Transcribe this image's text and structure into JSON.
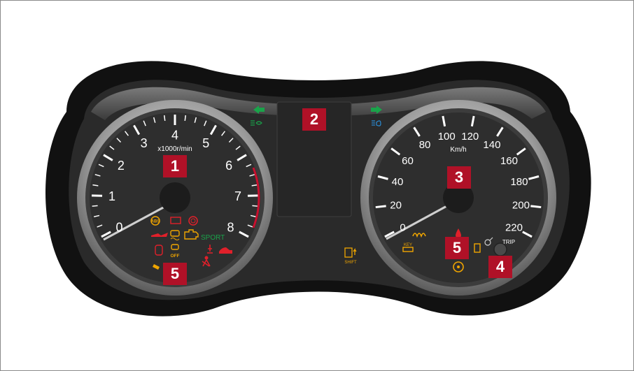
{
  "tachometer": {
    "unit_label": "x1000r/min",
    "scale": [
      "0",
      "1",
      "2",
      "3",
      "4",
      "5",
      "6",
      "7",
      "8"
    ]
  },
  "speedometer": {
    "unit_label": "Km/h",
    "scale": [
      "0",
      "20",
      "40",
      "60",
      "80",
      "100",
      "120",
      "140",
      "160",
      "180",
      "200",
      "220"
    ]
  },
  "indicators": {
    "sport": "SPORT",
    "esp_off": "OFF",
    "key": "KEY",
    "shift": "SHIFT",
    "trip": "TRIP"
  },
  "callouts": {
    "tach": "1",
    "display": "2",
    "speedo": "3",
    "trip_knob": "4",
    "warn_left": "5",
    "warn_right": "5"
  },
  "colors": {
    "callout": "#b01127",
    "amber": "#f0a500",
    "red": "#e0202a",
    "green": "#1aa34a",
    "blue": "#2a8cd4"
  }
}
